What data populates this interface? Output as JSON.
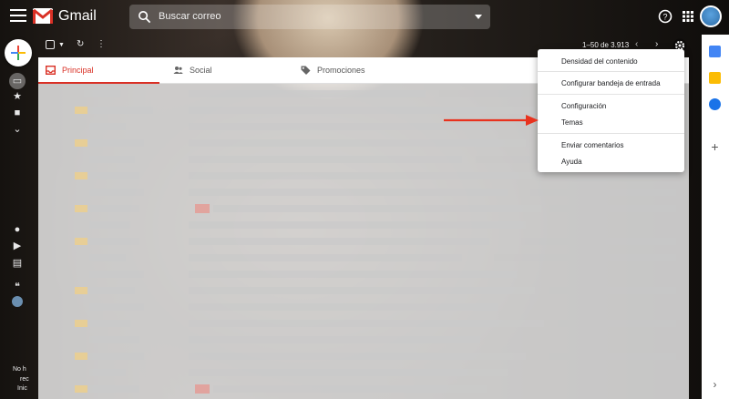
{
  "header": {
    "app_name": "Gmail",
    "search_placeholder": "Buscar correo",
    "icons": [
      "menu-icon",
      "gmail-logo-icon",
      "search-icon",
      "dropdown-caret-icon",
      "help-icon",
      "apps-grid-icon",
      "avatar"
    ]
  },
  "toolbar": {
    "pagination": "1–50 de 3.913",
    "icons": [
      "select-checkbox",
      "select-caret-icon",
      "refresh-icon",
      "more-vert-icon",
      "prev-page-icon",
      "next-page-icon",
      "settings-gear-icon"
    ]
  },
  "tabs": [
    {
      "label": "Principal",
      "icon": "inbox-icon",
      "active": true
    },
    {
      "label": "Social",
      "icon": "people-icon",
      "active": false
    },
    {
      "label": "Promociones",
      "icon": "tag-icon",
      "active": false
    }
  ],
  "settings_menu": {
    "items": [
      {
        "label": "Densidad del contenido"
      },
      {
        "label": "Configurar bandeja de entrada"
      },
      {
        "label": "Configuración"
      },
      {
        "label": "Temas"
      },
      {
        "label": "Enviar comentarios"
      },
      {
        "label": "Ayuda"
      }
    ]
  },
  "left_rail": {
    "texts": [
      "No h",
      "rec",
      "Inic"
    ]
  },
  "colors": {
    "accent_red": "#d93025",
    "annotation_arrow": "#e8321e",
    "toolbar_text": "#ffffff"
  }
}
